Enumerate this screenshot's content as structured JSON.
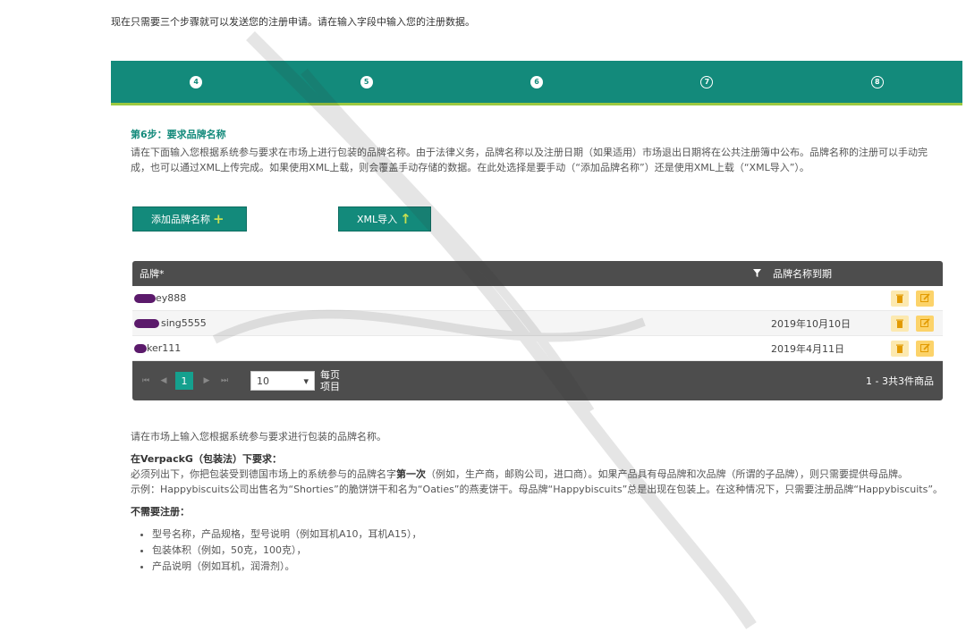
{
  "intro": "现在只需要三个步骤就可以发送您的注册申请。请在输入字段中输入您的注册数据。",
  "steps": [
    {
      "num": "4",
      "state": "done"
    },
    {
      "num": "5",
      "state": "done"
    },
    {
      "num": "6",
      "state": "current"
    },
    {
      "num": "7",
      "state": "todo"
    },
    {
      "num": "8",
      "state": "todo"
    }
  ],
  "step_title": "第6步：要求品牌名称",
  "step_desc": "请在下面输入您根据系统参与要求在市场上进行包装的品牌名称。由于法律义务，品牌名称以及注册日期（如果适用）市场退出日期将在公共注册簿中公布。品牌名称的注册可以手动完成，也可以通过XML上传完成。如果使用XML上载，则会覆盖手动存储的数据。在此处选择是要手动（“添加品牌名称”）还是使用XML上载（“XML导入”）。",
  "buttons": {
    "add": "添加品牌名称",
    "add_icon": "+",
    "xml": "XML导入",
    "xml_icon": "↑"
  },
  "grid": {
    "col_brand": "品牌*",
    "col_date": "品牌名称到期",
    "rows": [
      {
        "brand": "ey888",
        "date": ""
      },
      {
        "brand": "sing5555",
        "date": "2019年10月10日"
      },
      {
        "brand": "ker111",
        "date": "2019年4月11日"
      }
    ],
    "current_page": "1",
    "page_size": "10",
    "per_page_label_1": "每页",
    "per_page_label_2": "项目",
    "info": "1 - 3共3件商品"
  },
  "notes": {
    "p1": "请在市场上输入您根据系统参与要求进行包装的品牌名称。",
    "h2": "在VerpackG（包装法）下要求：",
    "p2a": "必须列出下，你把包装受到德国市场上的系统参与的品牌名字",
    "p2b": "第一次",
    "p2c": "（例如，生产商，邮购公司，进口商）。如果产品具有母品牌和次品牌（所谓的子品牌），则只需要提供母品牌。",
    "p3": "示例：Happybiscuits公司出售名为“Shorties”的脆饼饼干和名为“Oaties”的燕麦饼干。母品牌“Happybiscuits”总是出现在包装上。在这种情况下，只需要注册品牌“Happybiscuits”。",
    "h4": "不需要注册：",
    "list": [
      "型号名称，产品规格，型号说明（例如耳机A10，耳机A15），",
      "包装体积（例如，50克，100克），",
      "产品说明（例如耳机，润滑剂）。"
    ]
  },
  "colors": {
    "primary": "#138a7b",
    "accent": "#9cc940",
    "grid_header": "#4d4d4d",
    "action": "#fcd36a"
  }
}
